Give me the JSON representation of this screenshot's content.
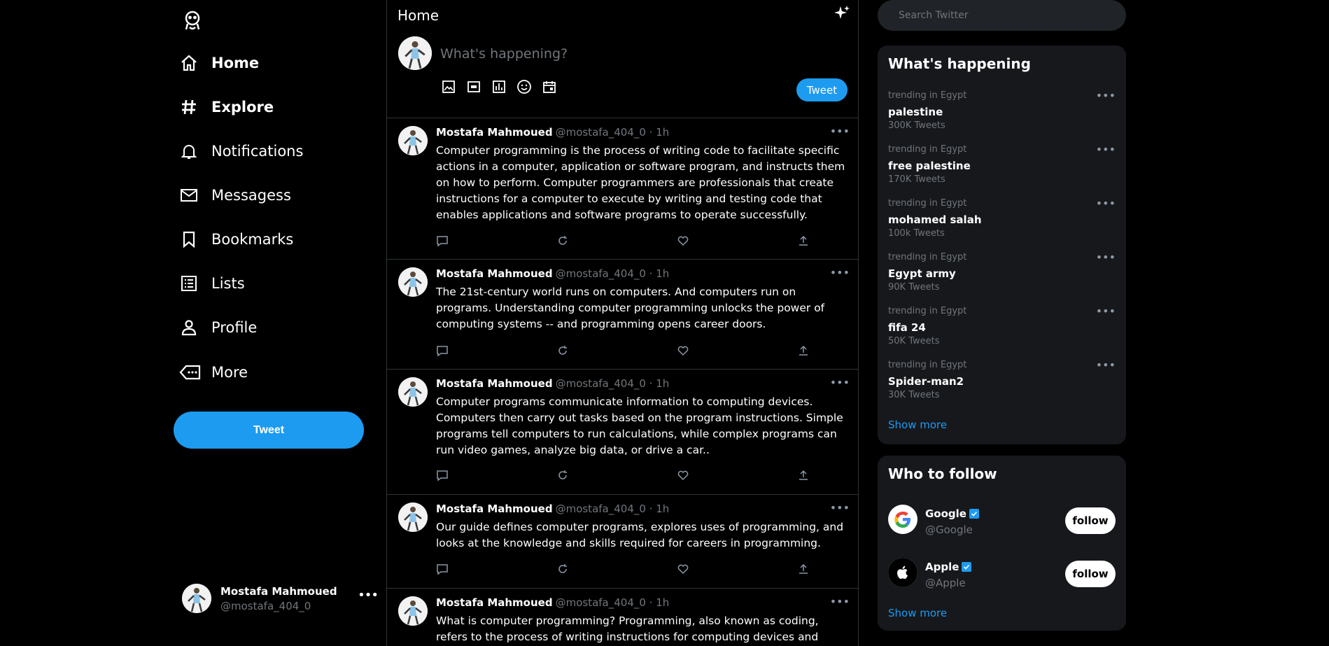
{
  "sidebar": {
    "logo_icon": "bird-mascot-icon",
    "nav": [
      {
        "label": "Home",
        "icon": "home-icon"
      },
      {
        "label": "Explore",
        "icon": "hashtag-icon"
      },
      {
        "label": "Notifications",
        "icon": "bell-icon"
      },
      {
        "label": "Messagess",
        "icon": "mail-icon"
      },
      {
        "label": "Bookmarks",
        "icon": "bookmark-icon"
      },
      {
        "label": "Lists",
        "icon": "list-icon"
      },
      {
        "label": "Profile",
        "icon": "person-icon"
      },
      {
        "label": "More",
        "icon": "more-tag-icon"
      }
    ],
    "tweet_button": "Tweet",
    "account": {
      "name": "Mostafa Mahmoued",
      "handle": "@mostafa_404_0",
      "more": "•••"
    }
  },
  "main": {
    "title": "Home",
    "composer": {
      "placeholder": "What's happening?",
      "tweet_button": "Tweet",
      "tools": [
        "image-icon",
        "gif-icon",
        "poll-icon",
        "emoji-icon",
        "schedule-icon"
      ]
    },
    "tweets": [
      {
        "name": "Mostafa Mahmoued",
        "handle": "@mostafa_404_0 · 1h",
        "text": "Computer programming is the process of writing code to facilitate specific actions in a computer, application or software program, and instructs them on how to perform. Computer programmers are professionals that create instructions for a computer to execute by writing and testing code that enables applications and software programs to operate successfully."
      },
      {
        "name": "Mostafa Mahmoued",
        "handle": "@mostafa_404_0 · 1h",
        "text": "The 21st-century world runs on computers. And computers run on programs. Understanding computer programming unlocks the power of computing systems -- and programming opens career doors."
      },
      {
        "name": "Mostafa Mahmoued",
        "handle": "@mostafa_404_0 · 1h",
        "text": "Computer programs communicate information to computing devices. Computers then carry out tasks based on the program instructions. Simple programs tell computers to run calculations, while complex programs can run video games, analyze big data, or drive a car.."
      },
      {
        "name": "Mostafa Mahmoued",
        "handle": "@mostafa_404_0 · 1h",
        "text": "Our guide defines computer programs, explores uses of programming, and looks at the knowledge and skills required for careers in programming."
      },
      {
        "name": "Mostafa Mahmoued",
        "handle": "@mostafa_404_0 · 1h",
        "text": "What is computer programming? Programming, also known as coding, refers to the process of writing instructions for computing devices and systems. A"
      }
    ],
    "tweet_more": "•••"
  },
  "right": {
    "search_placeholder": "Search Twitter",
    "trends_title": "What's happening",
    "trends": [
      {
        "context": "trending in Egypt",
        "topic": "palestine",
        "count": "300K Tweets"
      },
      {
        "context": "trending in Egypt",
        "topic": "free palestine",
        "count": "170K Tweets"
      },
      {
        "context": "trending in Egypt",
        "topic": "mohamed salah",
        "count": "100k Tweets"
      },
      {
        "context": "trending in Egypt",
        "topic": "Egypt army",
        "count": "90K Tweets"
      },
      {
        "context": "trending in Egypt",
        "topic": "fifa 24",
        "count": "50K Tweets"
      },
      {
        "context": "trending in Egypt",
        "topic": "Spider-man2",
        "count": "30K Tweets"
      }
    ],
    "trend_more": "•••",
    "show_more": "Show more",
    "follow_title": "Who to follow",
    "follow": [
      {
        "name": "Google",
        "handle": "@Google",
        "button": "follow"
      },
      {
        "name": "Apple",
        "handle": "@Apple",
        "button": "follow"
      }
    ],
    "follow_show_more": "Show more"
  },
  "colors": {
    "accent": "#1d9bf0",
    "background": "#000000",
    "panel": "#16181c",
    "muted": "#71767b"
  }
}
